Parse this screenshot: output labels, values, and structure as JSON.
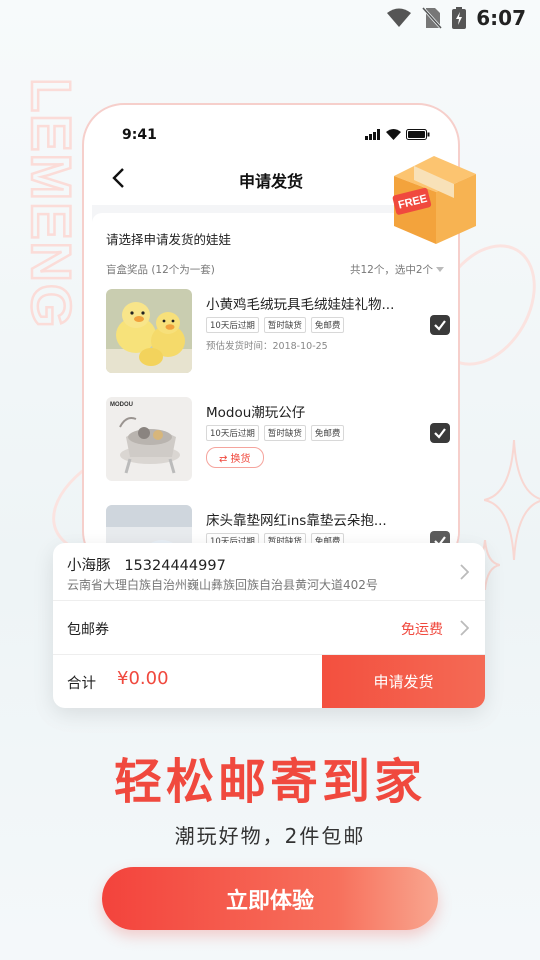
{
  "system_status": {
    "time": "6:07"
  },
  "watermark": "LEMENG",
  "phone": {
    "status_time": "9:41",
    "nav": {
      "title": "申请发货"
    },
    "select_title": "请选择申请发货的娃娃",
    "summary_left": "盲盒奖品 (12个为一套)",
    "summary_right": "共12个，选中2个",
    "badge": "FREE",
    "items": [
      {
        "name": "小黄鸡毛绒玩具毛绒娃娃礼物...",
        "tags": [
          "10天后过期",
          "暂时缺货",
          "免邮费"
        ],
        "meta": "预估发货时间：2018-10-25",
        "checked": true
      },
      {
        "name": "Modou潮玩公仔",
        "tags": [
          "10天后过期",
          "暂时缺货",
          "免邮费"
        ],
        "action": "⇄ 换货",
        "checked": true
      },
      {
        "name": "床头靠垫网红ins靠垫云朵抱...",
        "tags": [
          "10天后过期",
          "暂时缺货",
          "免邮费"
        ],
        "checked": true
      }
    ]
  },
  "panel": {
    "recipient": "小海豚   15324444997",
    "address": "云南省大理白族自治州巍山彝族回族自治县黄河大道402号",
    "coupon_label": "包邮券",
    "coupon_value": "免运费",
    "total_label": "合计",
    "total_amount": "¥0.00",
    "apply_label": "申请发货"
  },
  "headline": "轻松邮寄到家",
  "subline": "潮玩好物，2件包邮",
  "cta_label": "立即体验",
  "colors": {
    "accent": "#f0493e",
    "panel_bg": "#ffffff",
    "page_bg": "#f2f7f9"
  }
}
